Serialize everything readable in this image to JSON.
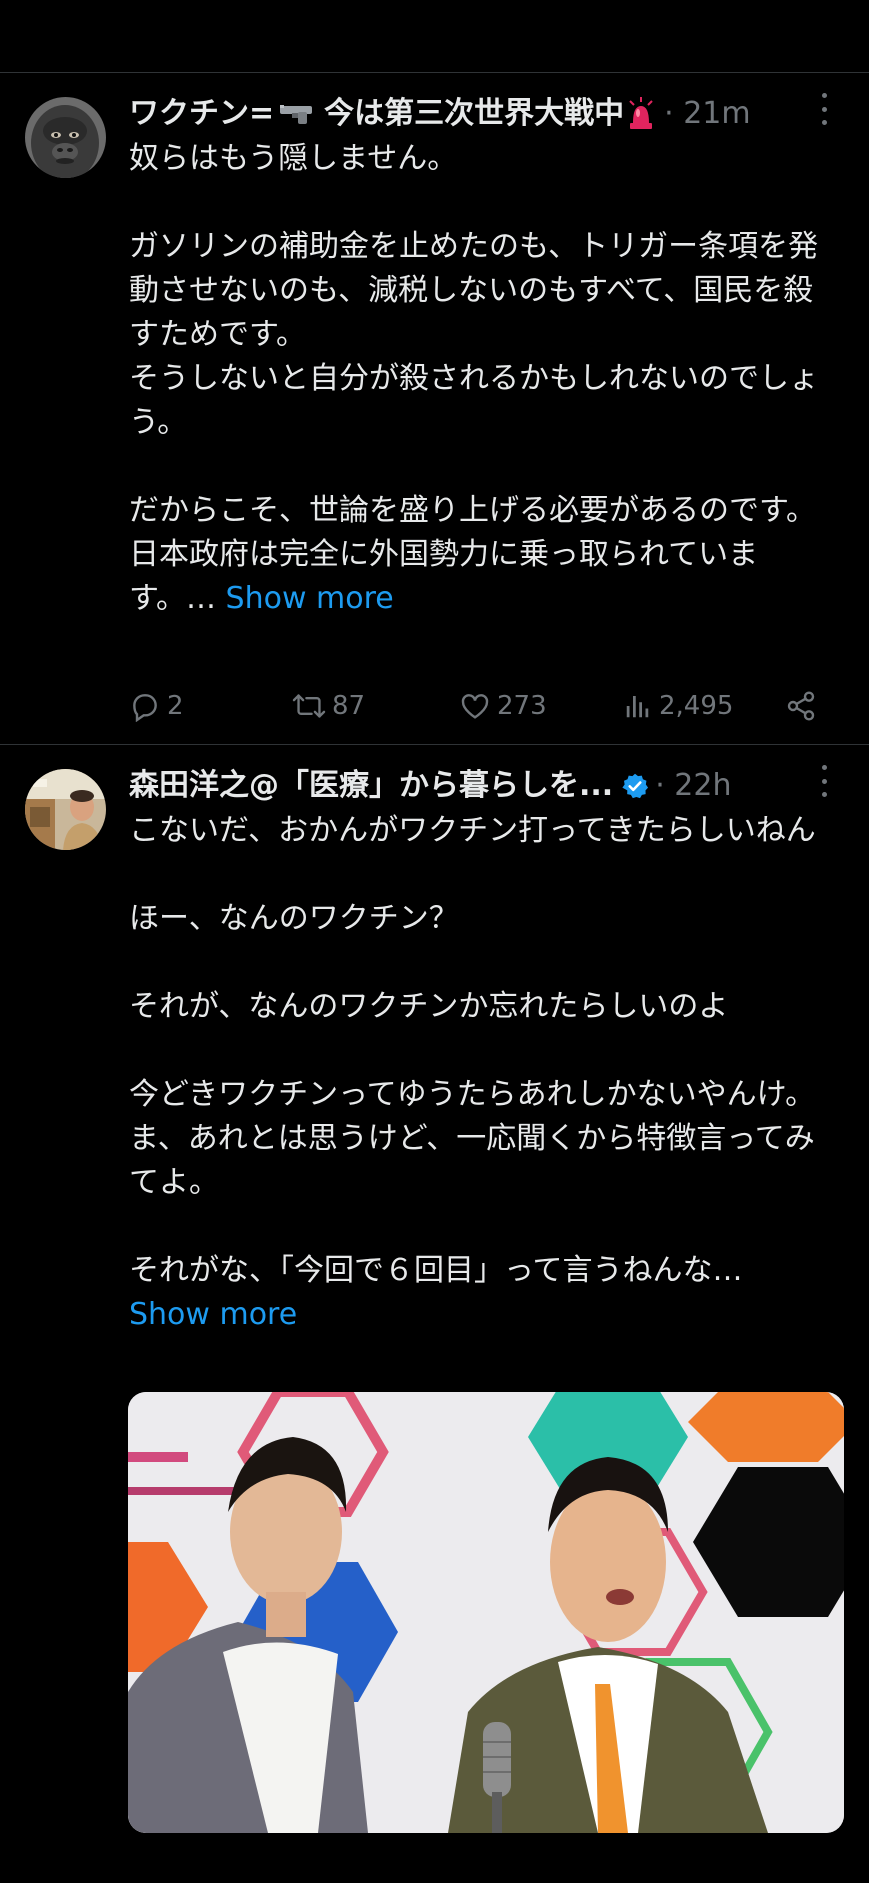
{
  "tweets": [
    {
      "author": {
        "display_name": "ワクチン=",
        "name_suffix": "今は第三次世界大戦中",
        "emoji_1": "pistol",
        "emoji_2": "rotating-light",
        "avatar": "gorilla-photo"
      },
      "time": "· 21m",
      "text": "奴らはもう隠しません。\n\nガソリンの補助金を止めたのも、トリガー条項を発動させないのも、減税しないのもすべて、国民を殺すためです。\nそうしないと自分が殺されるかもしれないのでしょう。\n\nだからこそ、世論を盛り上げる必要があるのです。\n日本政府は完全に外国勢力に乗っ取られています。… ",
      "show_more": "Show more",
      "stats": {
        "replies": "2",
        "reposts": "87",
        "likes": "273",
        "views": "2,495"
      }
    },
    {
      "author": {
        "display_name": "森田洋之@「医療」から暮らしを...",
        "verified": true,
        "avatar": "man-photo"
      },
      "time": "· 22h",
      "text": "こないだ、おかんがワクチン打ってきたらしいねん\n\nほー、なんのワクチン？\n\nそれが、なんのワクチンか忘れたらしいのよ\n\n今どきワクチンってゆうたらあれしかないやんけ。ま、あれとは思うけど、一応聞くから特徴言ってみてよ。\n\nそれがな、「今回で６回目」って言うねんな…\n",
      "show_more": "Show more",
      "media": "comedy-duo-photo"
    }
  ],
  "colors": {
    "background": "#000000",
    "text": "#e7e9ea",
    "muted": "#71767b",
    "link": "#1d9bf0",
    "divider": "#2f3336"
  }
}
